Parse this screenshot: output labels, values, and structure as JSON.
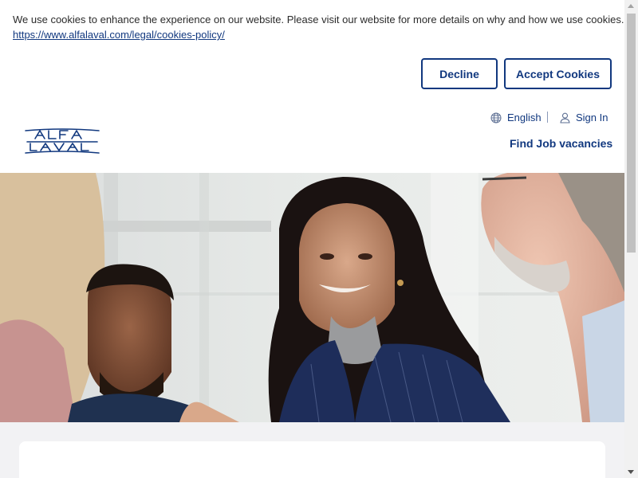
{
  "cookie_banner": {
    "message": "We use cookies to enhance the experience on our website. Please visit our website for more details on why and how we use cookies.",
    "policy_link": "https://www.alfalaval.com/legal/cookies-policy/",
    "decline_label": "Decline",
    "accept_label": "Accept Cookies"
  },
  "header": {
    "logo_text": "Alfa Laval",
    "language_label": "English",
    "signin_label": "Sign In",
    "nav_find_jobs": "Find Job vacancies"
  },
  "colors": {
    "brand_blue": "#11387f",
    "page_bg": "#f2f2f4"
  },
  "icons": {
    "language": "globe-icon",
    "signin": "user-icon"
  }
}
